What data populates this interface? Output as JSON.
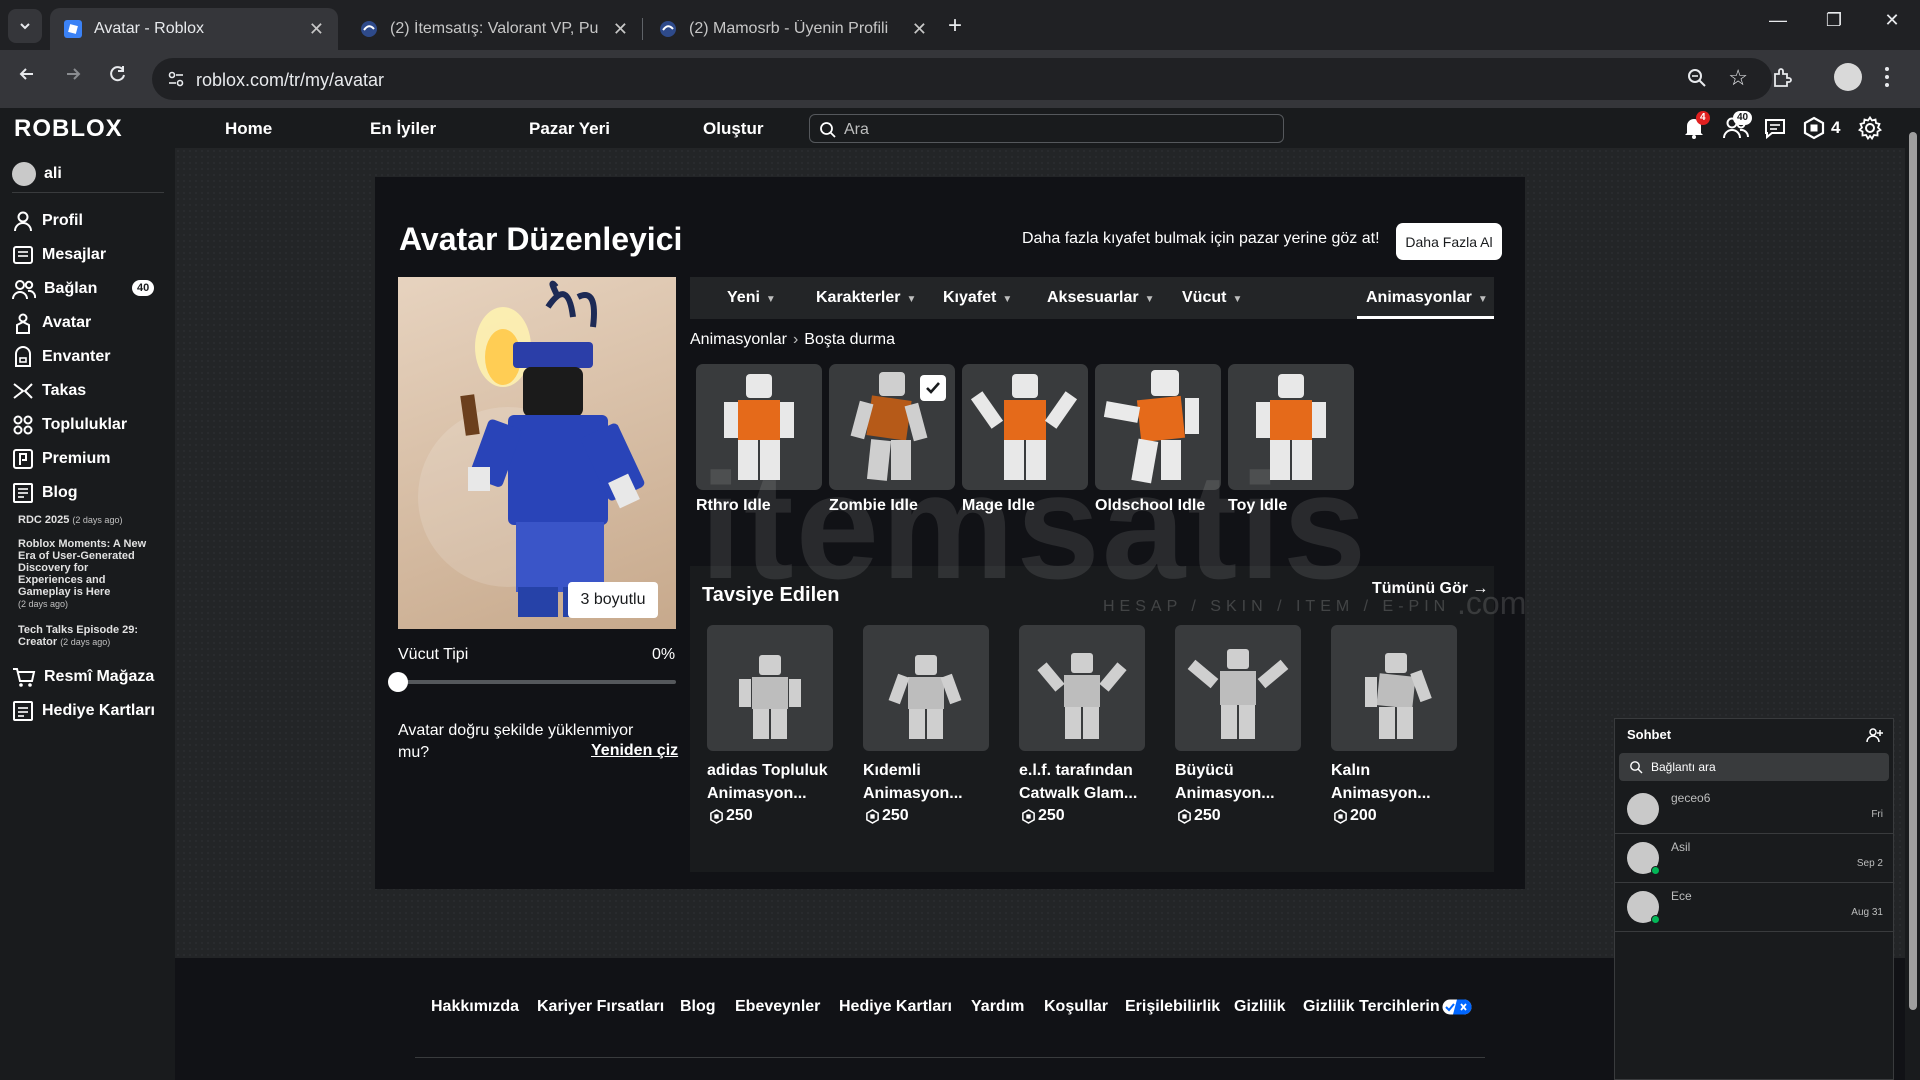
{
  "browser": {
    "tabs": [
      {
        "title": "Avatar - Roblox",
        "close": "✕"
      },
      {
        "title": "(2) İtemsatış: Valorant VP, Pu",
        "close": "✕"
      },
      {
        "title": "(2) Mamosrb - Üyenin Profili",
        "close": "✕"
      }
    ],
    "new_tab": "+",
    "url": "roblox.com/tr/my/avatar",
    "window_controls": {
      "minimize": "—",
      "restore": "❐",
      "close": "✕"
    }
  },
  "roblox_nav": {
    "logo": "ROBLOX",
    "links": [
      "Home",
      "En İyiler",
      "Pazar Yeri",
      "Oluştur"
    ],
    "search_placeholder": "Ara",
    "notifications_count": "4",
    "friends_count": "40",
    "robux": "4"
  },
  "sidebar": {
    "username": "ali",
    "items": [
      {
        "label": "Profil",
        "icon": "profile-icon"
      },
      {
        "label": "Mesajlar",
        "icon": "messages-icon"
      },
      {
        "label": "Bağlan",
        "icon": "friends-icon",
        "badge": "40"
      },
      {
        "label": "Avatar",
        "icon": "avatar-icon"
      },
      {
        "label": "Envanter",
        "icon": "inventory-icon"
      },
      {
        "label": "Takas",
        "icon": "trade-icon"
      },
      {
        "label": "Topluluklar",
        "icon": "groups-icon"
      },
      {
        "label": "Premium",
        "icon": "premium-icon"
      },
      {
        "label": "Blog",
        "icon": "blog-icon"
      }
    ],
    "blog_entries": [
      {
        "title": "RDC 2025",
        "ago": "(2 days ago)"
      },
      {
        "title": "Roblox Moments: A New Era of User-Generated Discovery for Experiences and Gameplay is Here",
        "ago": "(2 days ago)"
      },
      {
        "title": "Tech Talks Episode 29: Creator",
        "ago": "(2 days ago)"
      }
    ],
    "bottom_items": [
      {
        "label": "Resmî Mağaza",
        "icon": "store-icon"
      },
      {
        "label": "Hediye Kartları",
        "icon": "giftcard-icon"
      }
    ]
  },
  "editor": {
    "title": "Avatar Düzenleyici",
    "market_text": "Daha fazla kıyafet bulmak için pazar yerine göz at!",
    "buy_more": "Daha Fazla Al",
    "view_3d": "3 boyutlu",
    "body_type_label": "Vücut Tipi",
    "body_type_value": "0%",
    "body_type_fraction": 0,
    "redraw_question": "Avatar doğru şekilde yüklenmiyor mu?",
    "redraw_link": "Yeniden çiz",
    "categories": [
      "Yeni",
      "Karakterler",
      "Kıyafet",
      "Aksesuarlar",
      "Vücut",
      "Animasyonlar"
    ],
    "active_category": "Animasyonlar",
    "breadcrumb": [
      "Animasyonlar",
      "Boşta durma"
    ],
    "animations": [
      {
        "name": "Rthro Idle",
        "selected": false
      },
      {
        "name": "Zombie Idle",
        "selected": true
      },
      {
        "name": "Mage Idle",
        "selected": false
      },
      {
        "name": "Oldschool Idle",
        "selected": false
      },
      {
        "name": "Toy Idle",
        "selected": false
      }
    ],
    "recommended_title": "Tavsiye Edilen",
    "see_all": "Tümünü Gör →",
    "recommended": [
      {
        "name": "adidas Topluluk Animasyon...",
        "price": "250"
      },
      {
        "name": "Kıdemli Animasyon...",
        "price": "250"
      },
      {
        "name": "e.l.f. tarafından Catwalk Glam...",
        "price": "250"
      },
      {
        "name": "Büyücü Animasyon...",
        "price": "250"
      },
      {
        "name": "Kalın Animasyon...",
        "price": "200"
      }
    ]
  },
  "watermark": {
    "text": "itemsatis",
    "sub": "HESAP / SKIN / ITEM / E-PIN",
    "com": ".com"
  },
  "footer": {
    "links": [
      "Hakkımızda",
      "Kariyer Fırsatları",
      "Blog",
      "Ebeveynler",
      "Hediye Kartları",
      "Yardım",
      "Koşullar",
      "Erişilebilirlik",
      "Gizlilik",
      "Gizlilik Tercihlerin"
    ]
  },
  "chat": {
    "title": "Sohbet",
    "search_placeholder": "Bağlantı ara",
    "contacts": [
      {
        "name": "geceo6",
        "date": "Fri",
        "online": false
      },
      {
        "name": "Asil",
        "date": "Sep 2",
        "online": true
      },
      {
        "name": "Ece",
        "date": "Aug 31",
        "online": true
      }
    ]
  },
  "colors": {
    "accent_notification": "#e02020",
    "online": "#02b757",
    "active_tab_underline": "#ffffff"
  }
}
